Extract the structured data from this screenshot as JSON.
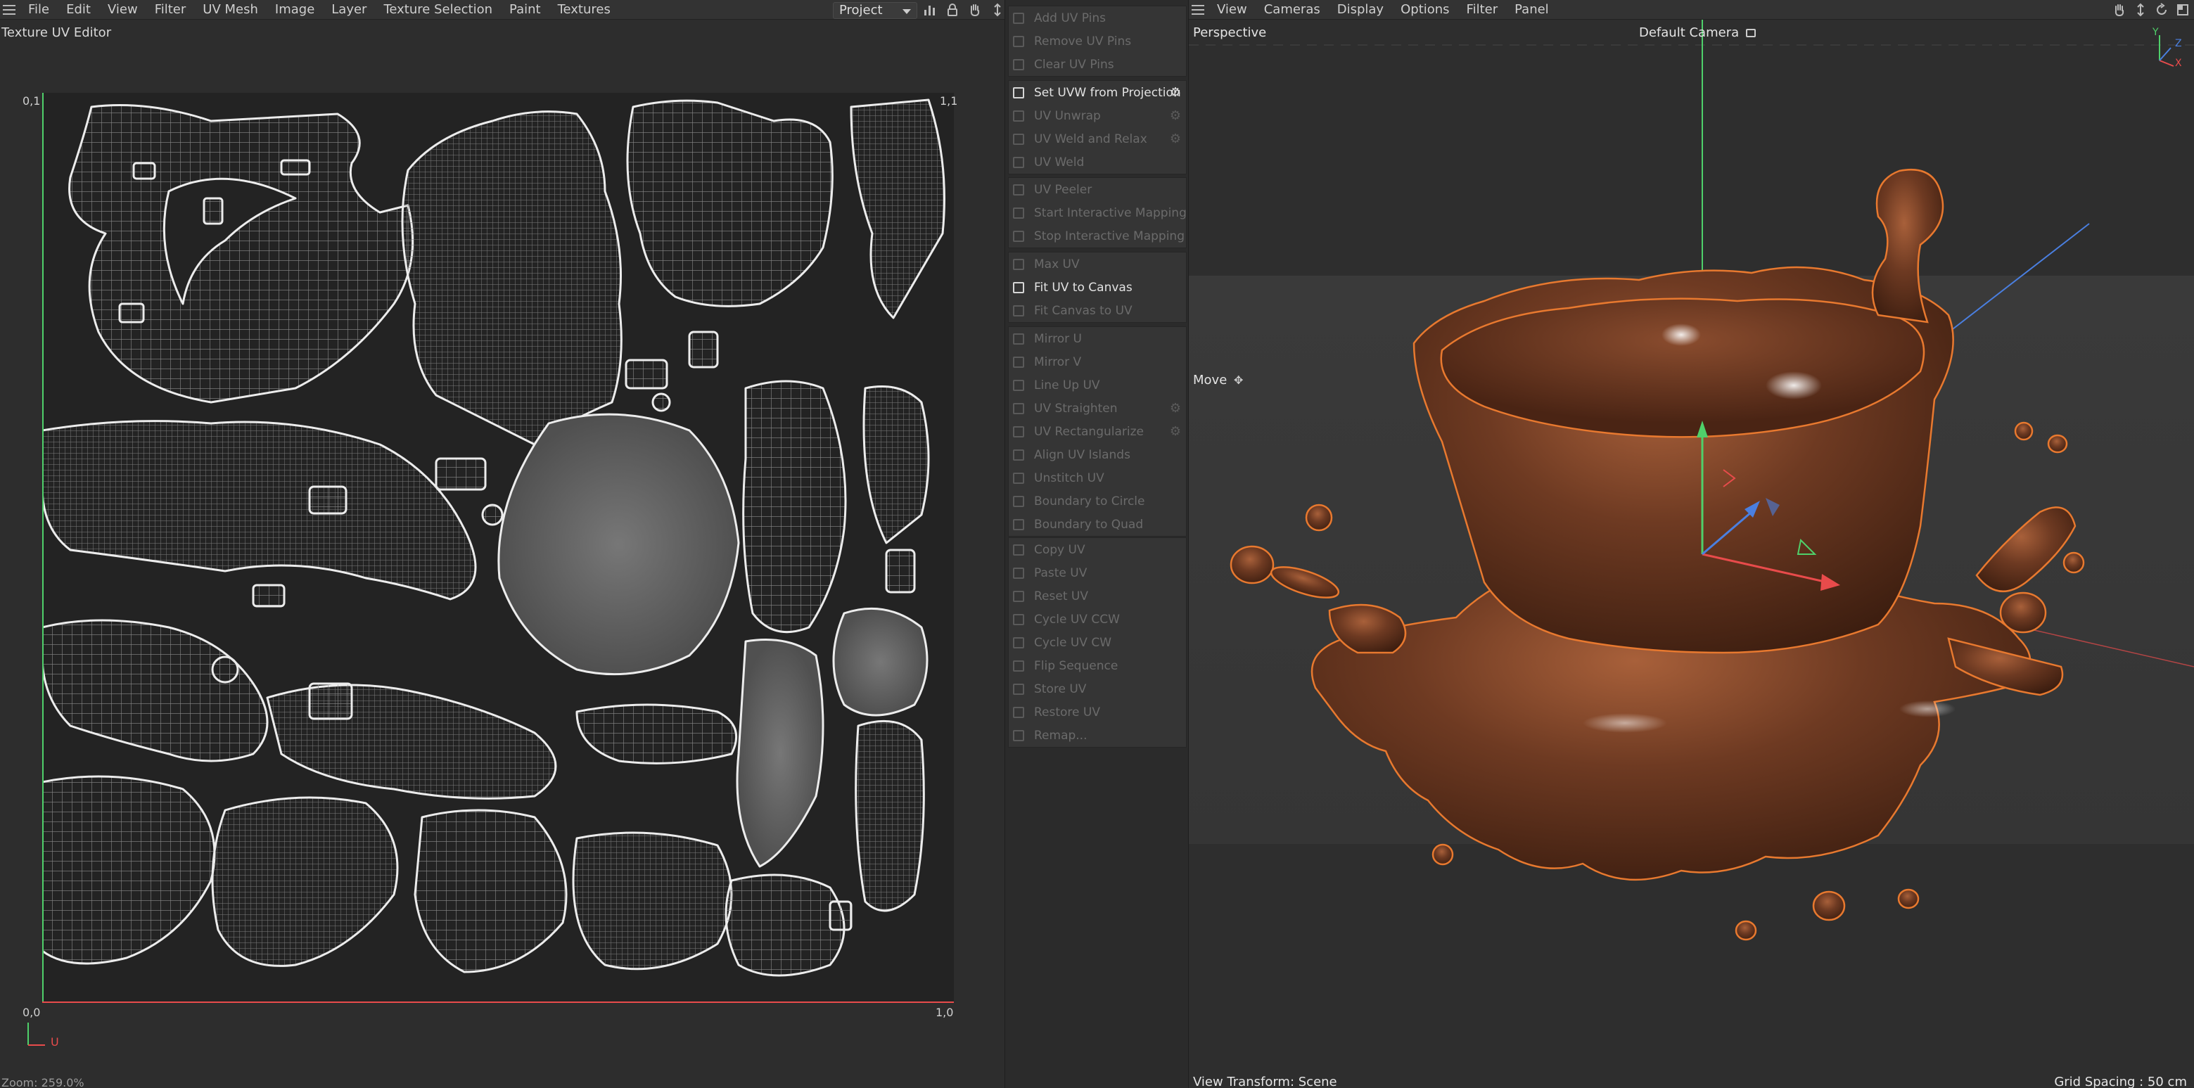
{
  "uv_editor": {
    "menu": [
      "File",
      "Edit",
      "View",
      "Filter",
      "UV Mesh",
      "Image",
      "Layer",
      "Texture Selection",
      "Paint",
      "Textures"
    ],
    "mode_select": "Project",
    "title": "Texture UV Editor",
    "corner_labels": {
      "top_left": "0,1",
      "top_right": "1,1",
      "bottom_left": "0,0",
      "bottom_right": "1,0"
    },
    "axis_label": "U",
    "zoom": "Zoom: 259.0%"
  },
  "uv_commands": {
    "groups": [
      [
        {
          "label": "Add UV Pins",
          "active": false,
          "settings": false
        },
        {
          "label": "Remove UV Pins",
          "active": false,
          "settings": false
        },
        {
          "label": "Clear UV Pins",
          "active": false,
          "settings": false
        }
      ],
      [
        {
          "label": "Set UVW from Projection",
          "active": true,
          "settings": true
        },
        {
          "label": "UV Unwrap",
          "active": false,
          "settings": true
        },
        {
          "label": "UV Weld and Relax",
          "active": false,
          "settings": true
        },
        {
          "label": "UV Weld",
          "active": false,
          "settings": false
        }
      ],
      [
        {
          "label": "UV Peeler",
          "active": false,
          "settings": false
        },
        {
          "label": "Start Interactive Mapping",
          "active": false,
          "settings": false
        },
        {
          "label": "Stop Interactive Mapping",
          "active": false,
          "settings": false
        }
      ],
      [
        {
          "label": "Max UV",
          "active": false,
          "settings": false
        },
        {
          "label": "Fit UV to Canvas",
          "active": true,
          "settings": false
        },
        {
          "label": "Fit Canvas to UV",
          "active": false,
          "settings": false
        }
      ],
      [
        {
          "label": "Mirror U",
          "active": false,
          "settings": false
        },
        {
          "label": "Mirror V",
          "active": false,
          "settings": false
        },
        {
          "label": "Line Up UV",
          "active": false,
          "settings": false
        },
        {
          "label": "UV Straighten",
          "active": false,
          "settings": true
        },
        {
          "label": "UV Rectangularize",
          "active": false,
          "settings": true
        },
        {
          "label": "Align UV Islands",
          "active": false,
          "settings": false
        },
        {
          "label": "Unstitch UV",
          "active": false,
          "settings": false
        },
        {
          "label": "Boundary to Circle",
          "active": false,
          "settings": false
        },
        {
          "label": "Boundary to Quad",
          "active": false,
          "settings": false
        }
      ],
      [
        {
          "label": "Copy UV",
          "active": false,
          "settings": false
        },
        {
          "label": "Paste UV",
          "active": false,
          "settings": false
        },
        {
          "label": "Reset UV",
          "active": false,
          "settings": false
        },
        {
          "label": "Cycle UV CCW",
          "active": false,
          "settings": false
        },
        {
          "label": "Cycle UV CW",
          "active": false,
          "settings": false
        },
        {
          "label": "Flip Sequence",
          "active": false,
          "settings": false
        },
        {
          "label": "Store UV",
          "active": false,
          "settings": false
        },
        {
          "label": "Restore UV",
          "active": false,
          "settings": false
        },
        {
          "label": "Remap...",
          "active": false,
          "settings": false
        }
      ]
    ]
  },
  "viewport": {
    "menu": [
      "View",
      "Cameras",
      "Display",
      "Options",
      "Filter",
      "Panel"
    ],
    "projection": "Perspective",
    "camera": "Default Camera",
    "tool": "Move",
    "view_transform": "View Transform: Scene",
    "grid_spacing": "Grid Spacing : 50 cm",
    "axis_labels": {
      "x": "X",
      "y": "Y",
      "z": "Z"
    }
  },
  "colors": {
    "accent_orange": "#e8792f",
    "chocolate": "#6e3a22",
    "axis_x": "#e84b4b",
    "axis_y": "#4fd06a",
    "axis_z": "#4a7fe0"
  }
}
